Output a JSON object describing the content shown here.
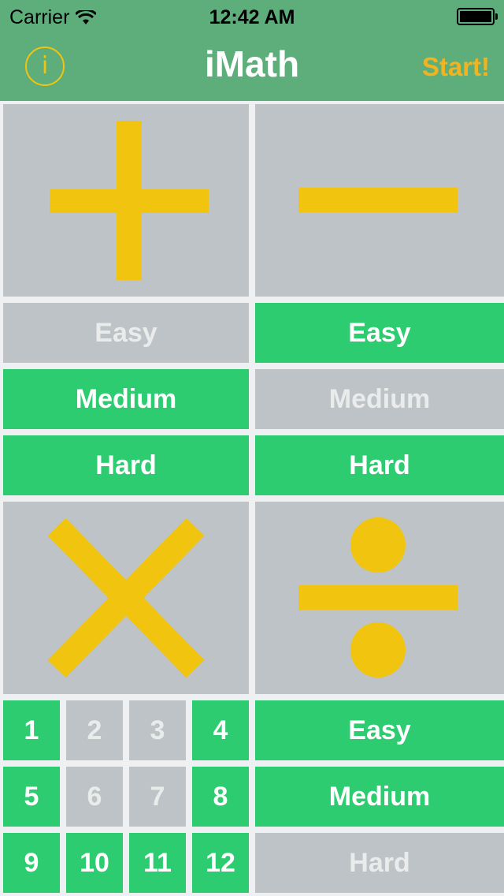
{
  "status_bar": {
    "carrier": "Carrier",
    "time": "12:42 AM"
  },
  "nav": {
    "info": "i",
    "title": "iMath",
    "start": "Start!"
  },
  "colors": {
    "selected": "#2ecc71",
    "unselected": "#bdc3c7",
    "operator": "#f1c40f",
    "header": "#5eae7c",
    "accent": "#f2b320"
  },
  "operations": [
    {
      "symbol": "plus-icon",
      "difficulty": [
        {
          "label": "Easy",
          "selected": false
        },
        {
          "label": "Medium",
          "selected": true
        },
        {
          "label": "Hard",
          "selected": true
        }
      ]
    },
    {
      "symbol": "minus-icon",
      "difficulty": [
        {
          "label": "Easy",
          "selected": true
        },
        {
          "label": "Medium",
          "selected": false
        },
        {
          "label": "Hard",
          "selected": true
        }
      ]
    },
    {
      "symbol": "multiply-icon",
      "tables": [
        {
          "n": "1",
          "selected": true
        },
        {
          "n": "2",
          "selected": false
        },
        {
          "n": "3",
          "selected": false
        },
        {
          "n": "4",
          "selected": true
        },
        {
          "n": "5",
          "selected": true
        },
        {
          "n": "6",
          "selected": false
        },
        {
          "n": "7",
          "selected": false
        },
        {
          "n": "8",
          "selected": true
        },
        {
          "n": "9",
          "selected": true
        },
        {
          "n": "10",
          "selected": true
        },
        {
          "n": "11",
          "selected": true
        },
        {
          "n": "12",
          "selected": true
        }
      ]
    },
    {
      "symbol": "divide-icon",
      "difficulty": [
        {
          "label": "Easy",
          "selected": true
        },
        {
          "label": "Medium",
          "selected": true
        },
        {
          "label": "Hard",
          "selected": false
        }
      ]
    }
  ]
}
